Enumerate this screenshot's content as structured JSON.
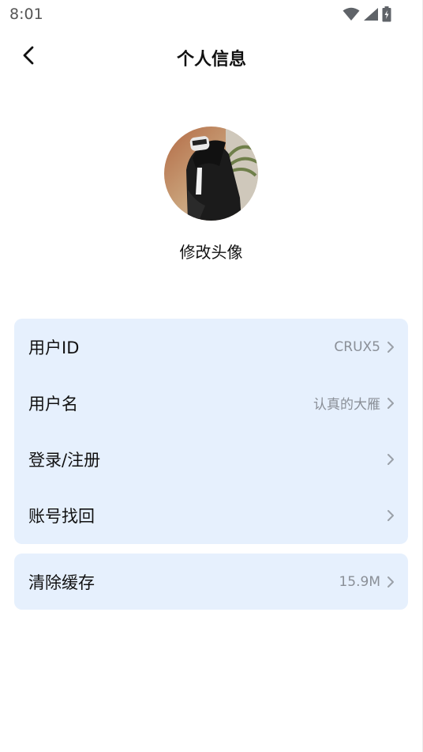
{
  "status_bar": {
    "time": "8:01",
    "icons": [
      "wifi-icon",
      "signal-icon",
      "battery-icon"
    ]
  },
  "header": {
    "title": "个人信息",
    "back_icon": "chevron-left-icon"
  },
  "avatar": {
    "caption": "修改头像"
  },
  "profile_items": [
    {
      "label": "用户ID",
      "value": "CRUX5"
    },
    {
      "label": "用户名",
      "value": "认真的大雁"
    },
    {
      "label": "登录/注册",
      "value": ""
    },
    {
      "label": "账号找回",
      "value": ""
    }
  ],
  "cache_item": {
    "label": "清除缓存",
    "value": "15.9M"
  },
  "colors": {
    "card_background": "#e6f0fd",
    "value_text": "#8a8f97",
    "chevron": "#9aa0a8"
  }
}
